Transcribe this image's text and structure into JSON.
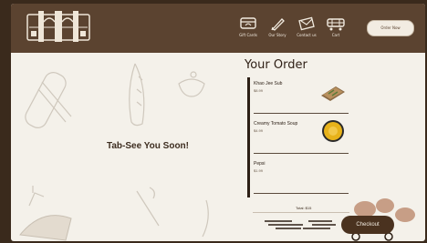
{
  "nav": {
    "items": [
      {
        "label": "Gift Cards",
        "icon": "gift-card-icon"
      },
      {
        "label": "Our Story",
        "icon": "pen-icon"
      },
      {
        "label": "Contact us",
        "icon": "envelope-icon"
      },
      {
        "label": "Cart",
        "icon": "cart-icon"
      }
    ],
    "order_now": "Order Now"
  },
  "main": {
    "farewell": "Tab-See You Soon!"
  },
  "order": {
    "title": "Your Order",
    "items": [
      {
        "name": "Khao Jee Sub",
        "price": "$8.99"
      },
      {
        "name": "Creamy Tomato Soup",
        "price": "$4.99"
      },
      {
        "name": "Pepsi",
        "price": "$1.99"
      }
    ],
    "total": "Total: $15",
    "checkout": "Checkout"
  },
  "colors": {
    "header": "#5b4330",
    "background": "#f4f1ea",
    "accent": "#4a321f"
  }
}
